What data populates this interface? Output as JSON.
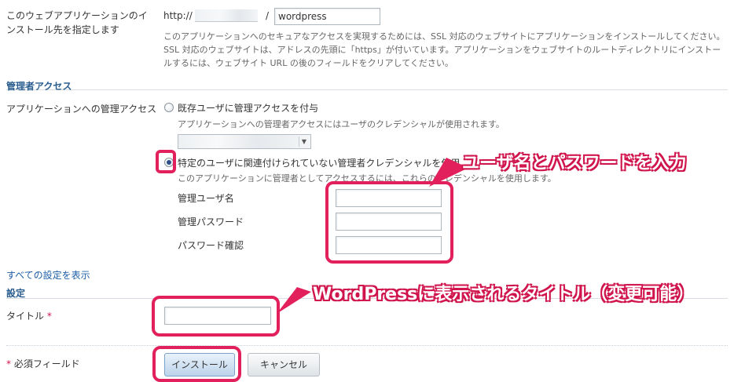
{
  "install_location": {
    "label": "このウェブアプリケーションのインストール先を指定します",
    "protocol": "http://",
    "separator": "/",
    "path_value": "wordpress",
    "hint": "このアプリケーションへのセキュアなアクセスを実現するためには、SSL 対応のウェブサイトにアプリケーションをインストールしてください。SSL 対応のウェブサイトは、アドレスの先頭に「https」が付いています。アプリケーションをウェブサイトのルートディレクトリにインストールするには、ウェブサイト URL の後のフィールドをクリアしてください。"
  },
  "admin_access": {
    "section_title": "管理者アクセス",
    "label": "アプリケーションへの管理アクセス",
    "option_existing": "既存ユーザに管理アクセスを付与",
    "option_existing_hint": "アプリケーションへの管理者アクセスにはユーザのクレデンシャルが使用されます。",
    "option_new": "特定のユーザに関連付けられていない管理者クレデンシャルを使用",
    "option_new_hint": "このアプリケーションに管理者としてアクセスするには、これらのクレデンシャルを使用します。",
    "username_label": "管理ユーザ名",
    "password_label": "管理パスワード",
    "confirm_label": "パスワード確認",
    "username_value": "",
    "password_value": "",
    "confirm_value": ""
  },
  "show_all_settings": "すべての設定を表示",
  "settings": {
    "section_title": "設定",
    "title_label": "タイトル",
    "required_star": "*",
    "title_value": ""
  },
  "footer": {
    "required_note": "必須フィールド",
    "required_star": "*",
    "install_button": "インストール",
    "cancel_button": "キャンセル"
  },
  "annotations": {
    "credentials": "ユーザ名とパスワードを入力",
    "title": "WordPressに表示されるタイトル（変更可能）"
  },
  "colors": {
    "annotation": "#e2215c",
    "section": "#2a5d8f",
    "link": "#1d5ea8"
  }
}
